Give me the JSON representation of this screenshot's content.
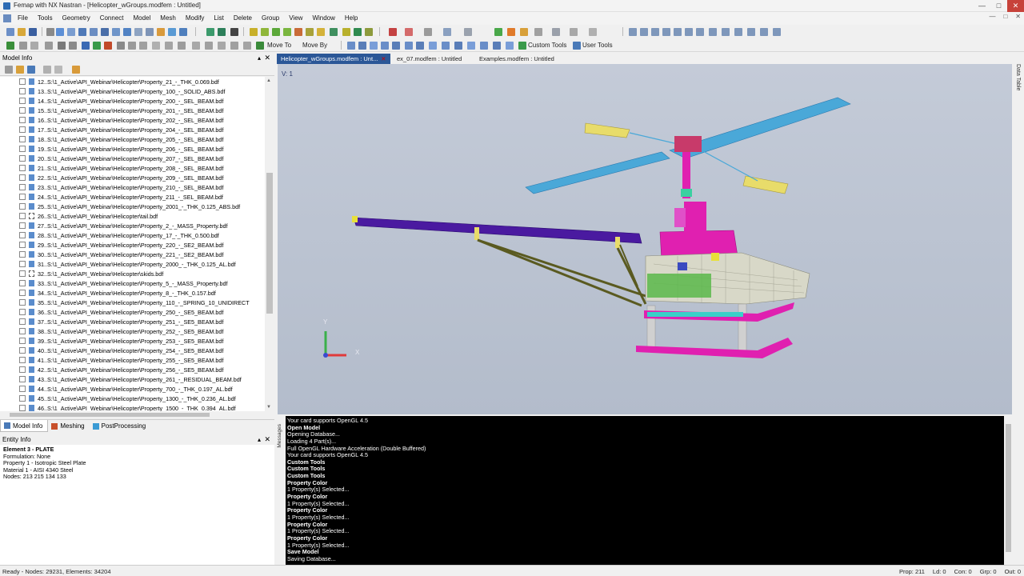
{
  "window": {
    "title": "Femap with NX Nastran - [Helicopter_wGroups.modfem : Untitled]",
    "controls": [
      "—",
      "□",
      "✕"
    ]
  },
  "menubar": {
    "items": [
      "File",
      "Tools",
      "Geometry",
      "Connect",
      "Model",
      "Mesh",
      "Modify",
      "List",
      "Delete",
      "Group",
      "View",
      "Window",
      "Help"
    ],
    "mdi_controls": [
      "—",
      "□",
      "✕"
    ]
  },
  "toolbar": {
    "move_to": "Move To",
    "move_by": "Move By",
    "custom_tools": "Custom Tools",
    "user_tools": "User Tools"
  },
  "model_info": {
    "title": "Model Info",
    "rows": [
      "12..S:\\1_Active\\API_Webinar\\Helicopter\\Property_21_-_THK_0.069.bdf",
      "13..S:\\1_Active\\API_Webinar\\Helicopter\\Property_100_-_SOLID_ABS.bdf",
      "14..S:\\1_Active\\API_Webinar\\Helicopter\\Property_200_-_SEL_BEAM.bdf",
      "15..S:\\1_Active\\API_Webinar\\Helicopter\\Property_201_-_SEL_BEAM.bdf",
      "16..S:\\1_Active\\API_Webinar\\Helicopter\\Property_202_-_SEL_BEAM.bdf",
      "17..S:\\1_Active\\API_Webinar\\Helicopter\\Property_204_-_SEL_BEAM.bdf",
      "18..S:\\1_Active\\API_Webinar\\Helicopter\\Property_205_-_SEL_BEAM.bdf",
      "19..S:\\1_Active\\API_Webinar\\Helicopter\\Property_206_-_SEL_BEAM.bdf",
      "20..S:\\1_Active\\API_Webinar\\Helicopter\\Property_207_-_SEL_BEAM.bdf",
      "21..S:\\1_Active\\API_Webinar\\Helicopter\\Property_208_-_SEL_BEAM.bdf",
      "22..S:\\1_Active\\API_Webinar\\Helicopter\\Property_209_-_SEL_BEAM.bdf",
      "23..S:\\1_Active\\API_Webinar\\Helicopter\\Property_210_-_SEL_BEAM.bdf",
      "24..S:\\1_Active\\API_Webinar\\Helicopter\\Property_211_-_SEL_BEAM.bdf",
      "25..S:\\1_Active\\API_Webinar\\Helicopter\\Property_2001_-_THK_0.125_ABS.bdf",
      "26..S:\\1_Active\\API_Webinar\\Helicopter\\tail.bdf",
      "27..S:\\1_Active\\API_Webinar\\Helicopter\\Property_2_-_MASS_Property.bdf",
      "28..S:\\1_Active\\API_Webinar\\Helicopter\\Property_17_-_THK_0.500.bdf",
      "29..S:\\1_Active\\API_Webinar\\Helicopter\\Property_220_-_SE2_BEAM.bdf",
      "30..S:\\1_Active\\API_Webinar\\Helicopter\\Property_221_-_SE2_BEAM.bdf",
      "31..S:\\1_Active\\API_Webinar\\Helicopter\\Property_2000_-_THK_0.125_AL.bdf",
      "32..S:\\1_Active\\API_Webinar\\Helicopter\\skids.bdf",
      "33..S:\\1_Active\\API_Webinar\\Helicopter\\Property_5_-_MASS_Property.bdf",
      "34..S:\\1_Active\\API_Webinar\\Helicopter\\Property_8_-_THK_0.157.bdf",
      "35..S:\\1_Active\\API_Webinar\\Helicopter\\Property_110_-_SPRING_10_UNIDIRECT",
      "36..S:\\1_Active\\API_Webinar\\Helicopter\\Property_250_-_SE5_BEAM.bdf",
      "37..S:\\1_Active\\API_Webinar\\Helicopter\\Property_251_-_SE5_BEAM.bdf",
      "38..S:\\1_Active\\API_Webinar\\Helicopter\\Property_252_-_SE5_BEAM.bdf",
      "39..S:\\1_Active\\API_Webinar\\Helicopter\\Property_253_-_SE5_BEAM.bdf",
      "40..S:\\1_Active\\API_Webinar\\Helicopter\\Property_254_-_SE5_BEAM.bdf",
      "41..S:\\1_Active\\API_Webinar\\Helicopter\\Property_255_-_SE5_BEAM.bdf",
      "42..S:\\1_Active\\API_Webinar\\Helicopter\\Property_256_-_SE5_BEAM.bdf",
      "43..S:\\1_Active\\API_Webinar\\Helicopter\\Property_261_-_RESIDUAL_BEAM.bdf",
      "44..S:\\1_Active\\API_Webinar\\Helicopter\\Property_700_-_THK_0.197_AL.bdf",
      "45..S:\\1_Active\\API_Webinar\\Helicopter\\Property_1300_-_THK_0.236_AL.bdf",
      "46..S:\\1_Active\\API_Webinar\\Helicopter\\Property_1500_-_THK_0.394_AL.bdf"
    ],
    "dashed_rows": [
      14,
      20
    ]
  },
  "panel_tabs": [
    "Model Info",
    "Meshing",
    "PostProcessing"
  ],
  "entity_info": {
    "title": "Entity Info",
    "lines": [
      "Element 3 - PLATE",
      "  Formulation: None",
      "Property 1 - Isotropic Steel Plate",
      "Material 1 - AISI 4340 Steel",
      "Nodes: 213 215 134 133"
    ]
  },
  "doc_tabs": [
    {
      "label": "Helicopter_wGroups.modfem : Unt...",
      "active": true
    },
    {
      "label": "ex_07.modfem : Untitled",
      "active": false
    },
    {
      "label": "Examples.modfem : Untitled",
      "active": false
    }
  ],
  "viewport": {
    "view_label": "V: 1",
    "axis_y": "Y",
    "axis_x": "X"
  },
  "right_bar_label": "Data Table",
  "messages_label": "Messages",
  "messages": [
    {
      "text": "Your card supports OpenGL 4.5",
      "bold": false
    },
    {
      "text": "Open Model",
      "bold": true
    },
    {
      "text": "Opening Database...",
      "bold": false
    },
    {
      "text": "Loading 4 Part(s)...",
      "bold": false
    },
    {
      "text": "Full OpenGL Hardware Acceleration (Double Buffered)",
      "bold": false
    },
    {
      "text": "Your card supports OpenGL 4.5",
      "bold": false
    },
    {
      "text": "Custom Tools",
      "bold": true
    },
    {
      "text": "Custom Tools",
      "bold": true
    },
    {
      "text": "Custom Tools",
      "bold": true
    },
    {
      "text": "Property Color",
      "bold": true
    },
    {
      "text": "1 Property(s) Selected...",
      "bold": false
    },
    {
      "text": "Property Color",
      "bold": true
    },
    {
      "text": "1 Property(s) Selected...",
      "bold": false
    },
    {
      "text": "Property Color",
      "bold": true
    },
    {
      "text": "1 Property(s) Selected...",
      "bold": false
    },
    {
      "text": "Property Color",
      "bold": true
    },
    {
      "text": "1 Property(s) Selected...",
      "bold": false
    },
    {
      "text": "Property Color",
      "bold": true
    },
    {
      "text": "1 Property(s) Selected...",
      "bold": false
    },
    {
      "text": "Save Model",
      "bold": true
    },
    {
      "text": "Saving Database...",
      "bold": false
    }
  ],
  "status": {
    "left": "Ready - Nodes: 29231, Elements: 34204",
    "prop": "Prop: 211",
    "ld": "Ld: 0",
    "con": "Con: 0",
    "grp": "Grp: 0",
    "out": "Out: 0"
  },
  "colors": {
    "rotor_blue": "#4aa8d8",
    "tail_purple": "#4a1aa0",
    "fuselage_magenta": "#e020b0",
    "strut_olive": "#5a5a20",
    "blade_yellow": "#e8dc6a"
  }
}
